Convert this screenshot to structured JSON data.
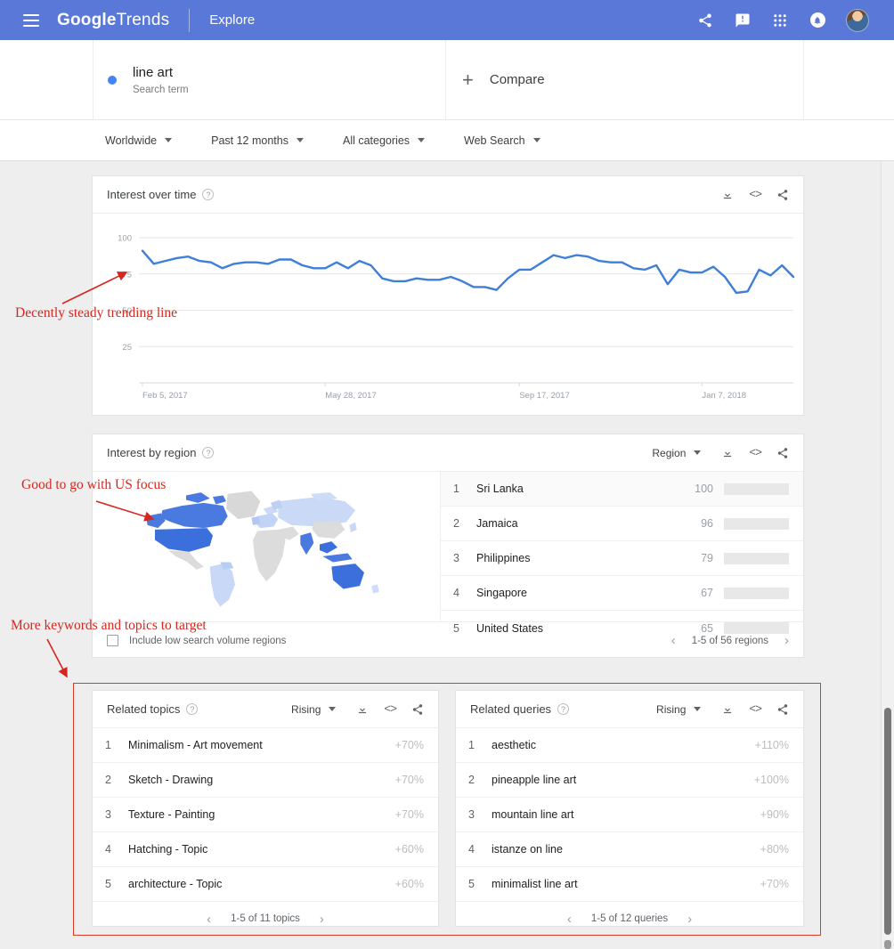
{
  "topbar": {
    "menu_icon": "hamburger-icon",
    "brand_google": "Google",
    "brand_trends": "Trends",
    "explore": "Explore",
    "icons": [
      "share-icon",
      "feedback-icon",
      "apps-grid-icon",
      "notification-bell-icon",
      "avatar"
    ]
  },
  "search": {
    "term": "line art",
    "term_type": "Search term",
    "compare_label": "Compare",
    "dot_color": "#4285f4"
  },
  "filters": [
    {
      "label": "Worldwide"
    },
    {
      "label": "Past 12 months"
    },
    {
      "label": "All categories"
    },
    {
      "label": "Web Search"
    }
  ],
  "interest_over_time": {
    "title": "Interest over time",
    "help": "?",
    "actions": [
      "download-icon",
      "embed-icon",
      "share-icon"
    ]
  },
  "interest_by_region": {
    "title": "Interest by region",
    "help": "?",
    "selector": "Region",
    "actions": [
      "download-icon",
      "embed-icon",
      "share-icon"
    ],
    "rows": [
      {
        "rank": "1",
        "name": "Sri Lanka",
        "value": "100",
        "pct": 100
      },
      {
        "rank": "2",
        "name": "Jamaica",
        "value": "96",
        "pct": 96
      },
      {
        "rank": "3",
        "name": "Philippines",
        "value": "79",
        "pct": 79
      },
      {
        "rank": "4",
        "name": "Singapore",
        "value": "67",
        "pct": 67
      },
      {
        "rank": "5",
        "name": "United States",
        "value": "65",
        "pct": 65
      }
    ],
    "checkbox_label": "Include low search volume regions",
    "pagination": "1-5 of 56 regions"
  },
  "related_topics": {
    "title": "Related topics",
    "help": "?",
    "sort": "Rising",
    "actions": [
      "download-icon",
      "embed-icon",
      "share-icon"
    ],
    "rows": [
      {
        "rank": "1",
        "name": "Minimalism - Art movement",
        "value": "+70%"
      },
      {
        "rank": "2",
        "name": "Sketch - Drawing",
        "value": "+70%"
      },
      {
        "rank": "3",
        "name": "Texture - Painting",
        "value": "+70%"
      },
      {
        "rank": "4",
        "name": "Hatching - Topic",
        "value": "+60%"
      },
      {
        "rank": "5",
        "name": "architecture - Topic",
        "value": "+60%"
      }
    ],
    "pagination": "1-5 of 11 topics"
  },
  "related_queries": {
    "title": "Related queries",
    "help": "?",
    "sort": "Rising",
    "actions": [
      "download-icon",
      "embed-icon",
      "share-icon"
    ],
    "rows": [
      {
        "rank": "1",
        "name": "aesthetic",
        "value": "+110%"
      },
      {
        "rank": "2",
        "name": "pineapple line art",
        "value": "+100%"
      },
      {
        "rank": "3",
        "name": "mountain line art",
        "value": "+90%"
      },
      {
        "rank": "4",
        "name": "istanze on line",
        "value": "+80%"
      },
      {
        "rank": "5",
        "name": "minimalist line art",
        "value": "+70%"
      }
    ],
    "pagination": "1-5 of 12 queries"
  },
  "annotations": [
    {
      "text": "Decently steady trending line",
      "color": "#d7261e"
    },
    {
      "text": "Good to go with US focus",
      "color": "#d7261e"
    },
    {
      "text": "More keywords and topics to target",
      "color": "#d7261e"
    }
  ],
  "chart_data": {
    "type": "line",
    "title": "Interest over time",
    "xlabel": "",
    "ylabel": "",
    "ylim": [
      0,
      108
    ],
    "yticks": [
      "100",
      "75",
      "50",
      "25"
    ],
    "ytick_values": [
      100,
      75,
      50,
      25
    ],
    "xticks": [
      "Feb 5, 2017",
      "May 28, 2017",
      "Sep 17, 2017",
      "Jan 7, 2018"
    ],
    "xtick_positions": [
      0,
      16,
      33,
      49
    ],
    "grid": true,
    "legend": "none",
    "line_color": "#3f7fd8",
    "series": [
      {
        "name": "line art",
        "values": [
          91,
          82,
          84,
          86,
          87,
          84,
          83,
          79,
          82,
          83,
          83,
          82,
          85,
          85,
          81,
          79,
          79,
          83,
          79,
          84,
          81,
          72,
          70,
          70,
          72,
          71,
          71,
          73,
          70,
          66,
          66,
          64,
          72,
          78,
          78,
          83,
          88,
          86,
          88,
          87,
          84,
          83,
          83,
          79,
          78,
          81,
          68,
          78,
          76,
          76,
          80,
          73,
          62,
          63,
          78,
          74,
          81,
          73
        ]
      }
    ]
  }
}
